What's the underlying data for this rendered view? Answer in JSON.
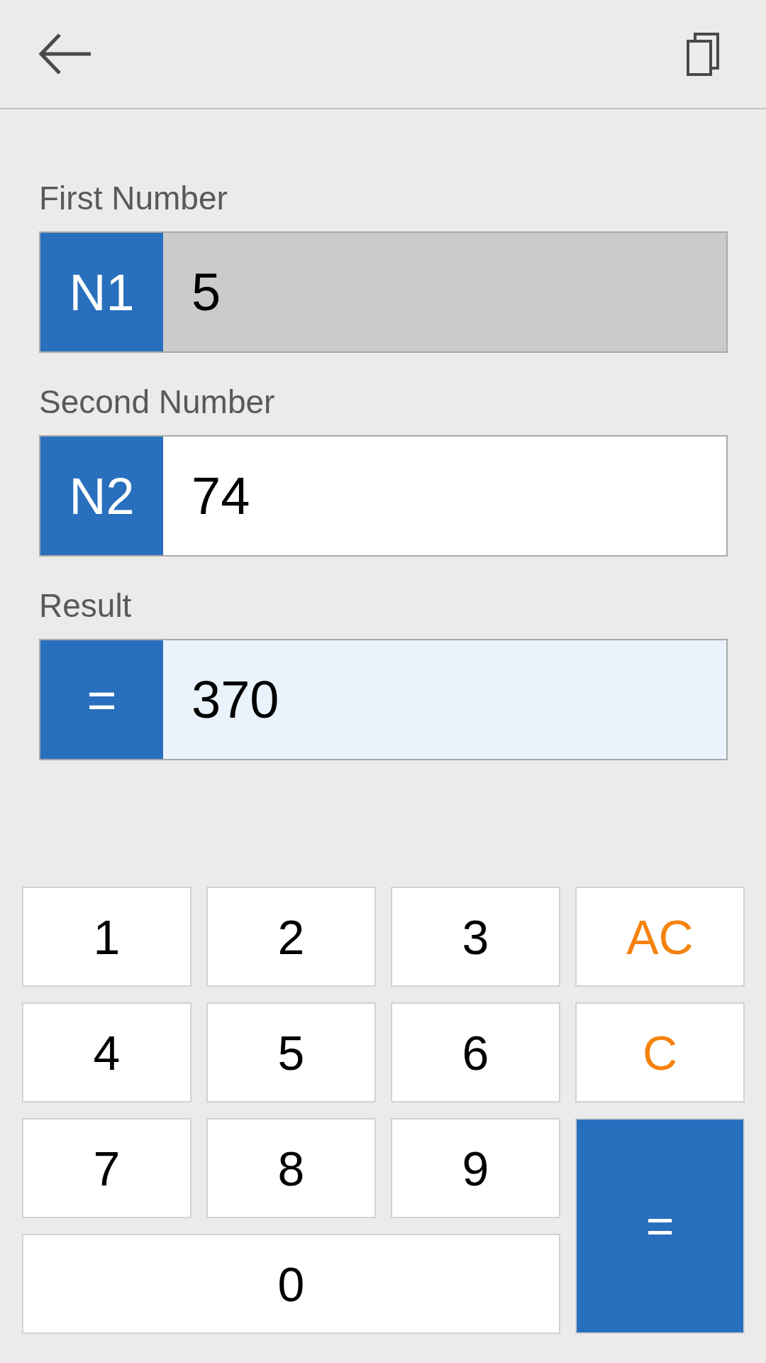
{
  "fields": [
    {
      "label": "First Number",
      "tag": "N1",
      "value": "5",
      "kind": "input",
      "selected": true
    },
    {
      "label": "Second Number",
      "tag": "N2",
      "value": "74",
      "kind": "input",
      "selected": false
    },
    {
      "label": "Result",
      "tag": "=",
      "value": "370",
      "kind": "result",
      "selected": false
    }
  ],
  "keypad": [
    {
      "label": "1",
      "kind": "digit"
    },
    {
      "label": "2",
      "kind": "digit"
    },
    {
      "label": "3",
      "kind": "digit"
    },
    {
      "label": "AC",
      "kind": "clear"
    },
    {
      "label": "4",
      "kind": "digit"
    },
    {
      "label": "5",
      "kind": "digit"
    },
    {
      "label": "6",
      "kind": "digit"
    },
    {
      "label": "C",
      "kind": "clear"
    },
    {
      "label": "7",
      "kind": "digit"
    },
    {
      "label": "8",
      "kind": "digit"
    },
    {
      "label": "9",
      "kind": "digit"
    },
    {
      "label": "=",
      "kind": "equals"
    },
    {
      "label": "0",
      "kind": "wide"
    }
  ]
}
